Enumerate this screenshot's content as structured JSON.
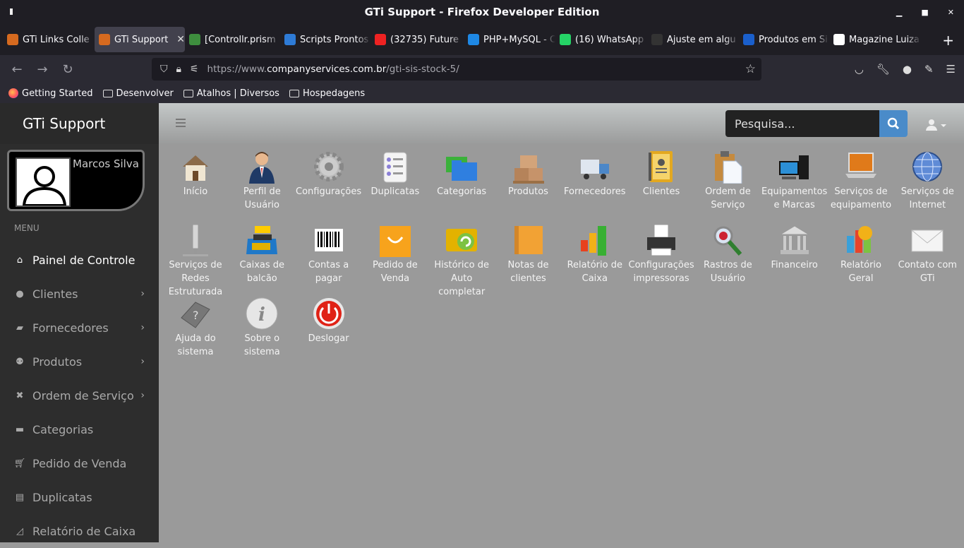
{
  "window": {
    "title": "GTi Support - Firefox Developer Edition"
  },
  "tabs": [
    {
      "label": "GTi Links Colle",
      "color": "#d66a1f"
    },
    {
      "label": "GTi Support",
      "color": "#d66a1f",
      "active": true
    },
    {
      "label": "[Controllr.prism",
      "color": "#3e8e3e"
    },
    {
      "label": "Scripts Prontos",
      "color": "#2e7bd6"
    },
    {
      "label": "(32735) Future",
      "color": "#e22"
    },
    {
      "label": "PHP+MySQL - C",
      "color": "#1e88e5"
    },
    {
      "label": "(16) WhatsApp",
      "color": "#25d366"
    },
    {
      "label": "Ajuste em algu",
      "color": "#333"
    },
    {
      "label": "Produtos em Si",
      "color": "#1a5fcc"
    },
    {
      "label": "Magazine Luiza",
      "color": "#fff"
    }
  ],
  "nav": {
    "url_prefix": "https://www.",
    "url_domain": "companyservices.com.br",
    "url_path": "/gti-sis-stock-5/"
  },
  "bookmarks": [
    {
      "label": "Getting Started"
    },
    {
      "label": "Desenvolver"
    },
    {
      "label": "Atalhos | Diversos"
    },
    {
      "label": "Hospedagens"
    }
  ],
  "app": {
    "brand": "GTi Support",
    "user": "Marcos Silva",
    "menu_header": "MENU",
    "search_placeholder": "Pesquisa...",
    "menu": [
      {
        "label": "Painel de Controle",
        "icon": "home-icon",
        "active": true,
        "chev": false
      },
      {
        "label": "Clientes",
        "icon": "user-icon",
        "chev": true
      },
      {
        "label": "Fornecedores",
        "icon": "truck-icon",
        "chev": true
      },
      {
        "label": "Produtos",
        "icon": "users-icon",
        "chev": true
      },
      {
        "label": "Ordem de Serviço",
        "icon": "wrench-icon",
        "chev": true
      },
      {
        "label": "Categorias",
        "icon": "folder-icon",
        "chev": false
      },
      {
        "label": "Pedido de Venda",
        "icon": "cart-icon",
        "chev": false
      },
      {
        "label": "Duplicatas",
        "icon": "card-icon",
        "chev": false
      },
      {
        "label": "Relatório de Caixa",
        "icon": "chart-icon",
        "chev": false
      }
    ],
    "tiles": [
      {
        "label": "Início",
        "icon": "house-icon"
      },
      {
        "label": "Perfil de Usuário",
        "icon": "businessman-icon"
      },
      {
        "label": "Configurações",
        "icon": "gear-icon"
      },
      {
        "label": "Duplicatas",
        "icon": "checklist-icon"
      },
      {
        "label": "Categorias",
        "icon": "folders-icon"
      },
      {
        "label": "Produtos",
        "icon": "boxes-icon"
      },
      {
        "label": "Fornecedores",
        "icon": "truck-icon"
      },
      {
        "label": "Clientes",
        "icon": "addressbook-icon"
      },
      {
        "label": "Ordem de Serviço",
        "icon": "clipboard-icon"
      },
      {
        "label": "Equipamentos e Marcas",
        "icon": "computer-icon"
      },
      {
        "label": "Serviços de equipamento",
        "icon": "laptop-icon"
      },
      {
        "label": "Serviços de Internet",
        "icon": "globe-icon"
      },
      {
        "label": "Serviços de Redes Estruturada",
        "icon": "network-icon"
      },
      {
        "label": "Caixas de balcão",
        "icon": "cashregister-icon"
      },
      {
        "label": "Contas a pagar",
        "icon": "barcode-icon"
      },
      {
        "label": "Pedido de Venda",
        "icon": "shopping-bag-icon"
      },
      {
        "label": "Histórico de Auto completar",
        "icon": "refresh-icon"
      },
      {
        "label": "Notas de clientes",
        "icon": "notebook-icon"
      },
      {
        "label": "Relatório de Caixa",
        "icon": "bar-chart-icon"
      },
      {
        "label": "Configurações impressoras",
        "icon": "printer-icon"
      },
      {
        "label": "Rastros de Usuário",
        "icon": "magnifier-icon"
      },
      {
        "label": "Financeiro",
        "icon": "bank-icon"
      },
      {
        "label": "Relatório Geral",
        "icon": "pie-chart-icon"
      },
      {
        "label": "Contato com GTi",
        "icon": "envelope-icon"
      },
      {
        "label": "Ajuda do sistema",
        "icon": "help-icon"
      },
      {
        "label": "Sobre o sistema",
        "icon": "info-icon"
      },
      {
        "label": "Deslogar",
        "icon": "power-icon"
      }
    ]
  }
}
